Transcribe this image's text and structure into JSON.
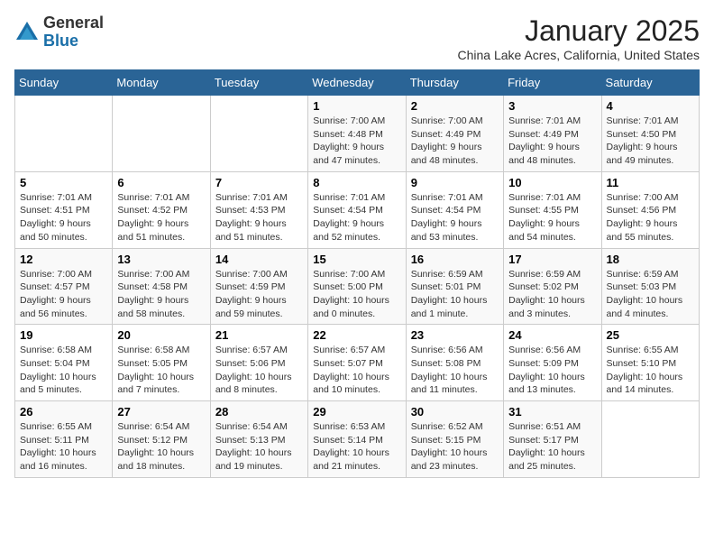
{
  "header": {
    "logo_general": "General",
    "logo_blue": "Blue",
    "month_title": "January 2025",
    "location": "China Lake Acres, California, United States"
  },
  "days_of_week": [
    "Sunday",
    "Monday",
    "Tuesday",
    "Wednesday",
    "Thursday",
    "Friday",
    "Saturday"
  ],
  "weeks": [
    [
      {
        "day": "",
        "info": ""
      },
      {
        "day": "",
        "info": ""
      },
      {
        "day": "",
        "info": ""
      },
      {
        "day": "1",
        "info": "Sunrise: 7:00 AM\nSunset: 4:48 PM\nDaylight: 9 hours and 47 minutes."
      },
      {
        "day": "2",
        "info": "Sunrise: 7:00 AM\nSunset: 4:49 PM\nDaylight: 9 hours and 48 minutes."
      },
      {
        "day": "3",
        "info": "Sunrise: 7:01 AM\nSunset: 4:49 PM\nDaylight: 9 hours and 48 minutes."
      },
      {
        "day": "4",
        "info": "Sunrise: 7:01 AM\nSunset: 4:50 PM\nDaylight: 9 hours and 49 minutes."
      }
    ],
    [
      {
        "day": "5",
        "info": "Sunrise: 7:01 AM\nSunset: 4:51 PM\nDaylight: 9 hours and 50 minutes."
      },
      {
        "day": "6",
        "info": "Sunrise: 7:01 AM\nSunset: 4:52 PM\nDaylight: 9 hours and 51 minutes."
      },
      {
        "day": "7",
        "info": "Sunrise: 7:01 AM\nSunset: 4:53 PM\nDaylight: 9 hours and 51 minutes."
      },
      {
        "day": "8",
        "info": "Sunrise: 7:01 AM\nSunset: 4:54 PM\nDaylight: 9 hours and 52 minutes."
      },
      {
        "day": "9",
        "info": "Sunrise: 7:01 AM\nSunset: 4:54 PM\nDaylight: 9 hours and 53 minutes."
      },
      {
        "day": "10",
        "info": "Sunrise: 7:01 AM\nSunset: 4:55 PM\nDaylight: 9 hours and 54 minutes."
      },
      {
        "day": "11",
        "info": "Sunrise: 7:00 AM\nSunset: 4:56 PM\nDaylight: 9 hours and 55 minutes."
      }
    ],
    [
      {
        "day": "12",
        "info": "Sunrise: 7:00 AM\nSunset: 4:57 PM\nDaylight: 9 hours and 56 minutes."
      },
      {
        "day": "13",
        "info": "Sunrise: 7:00 AM\nSunset: 4:58 PM\nDaylight: 9 hours and 58 minutes."
      },
      {
        "day": "14",
        "info": "Sunrise: 7:00 AM\nSunset: 4:59 PM\nDaylight: 9 hours and 59 minutes."
      },
      {
        "day": "15",
        "info": "Sunrise: 7:00 AM\nSunset: 5:00 PM\nDaylight: 10 hours and 0 minutes."
      },
      {
        "day": "16",
        "info": "Sunrise: 6:59 AM\nSunset: 5:01 PM\nDaylight: 10 hours and 1 minute."
      },
      {
        "day": "17",
        "info": "Sunrise: 6:59 AM\nSunset: 5:02 PM\nDaylight: 10 hours and 3 minutes."
      },
      {
        "day": "18",
        "info": "Sunrise: 6:59 AM\nSunset: 5:03 PM\nDaylight: 10 hours and 4 minutes."
      }
    ],
    [
      {
        "day": "19",
        "info": "Sunrise: 6:58 AM\nSunset: 5:04 PM\nDaylight: 10 hours and 5 minutes."
      },
      {
        "day": "20",
        "info": "Sunrise: 6:58 AM\nSunset: 5:05 PM\nDaylight: 10 hours and 7 minutes."
      },
      {
        "day": "21",
        "info": "Sunrise: 6:57 AM\nSunset: 5:06 PM\nDaylight: 10 hours and 8 minutes."
      },
      {
        "day": "22",
        "info": "Sunrise: 6:57 AM\nSunset: 5:07 PM\nDaylight: 10 hours and 10 minutes."
      },
      {
        "day": "23",
        "info": "Sunrise: 6:56 AM\nSunset: 5:08 PM\nDaylight: 10 hours and 11 minutes."
      },
      {
        "day": "24",
        "info": "Sunrise: 6:56 AM\nSunset: 5:09 PM\nDaylight: 10 hours and 13 minutes."
      },
      {
        "day": "25",
        "info": "Sunrise: 6:55 AM\nSunset: 5:10 PM\nDaylight: 10 hours and 14 minutes."
      }
    ],
    [
      {
        "day": "26",
        "info": "Sunrise: 6:55 AM\nSunset: 5:11 PM\nDaylight: 10 hours and 16 minutes."
      },
      {
        "day": "27",
        "info": "Sunrise: 6:54 AM\nSunset: 5:12 PM\nDaylight: 10 hours and 18 minutes."
      },
      {
        "day": "28",
        "info": "Sunrise: 6:54 AM\nSunset: 5:13 PM\nDaylight: 10 hours and 19 minutes."
      },
      {
        "day": "29",
        "info": "Sunrise: 6:53 AM\nSunset: 5:14 PM\nDaylight: 10 hours and 21 minutes."
      },
      {
        "day": "30",
        "info": "Sunrise: 6:52 AM\nSunset: 5:15 PM\nDaylight: 10 hours and 23 minutes."
      },
      {
        "day": "31",
        "info": "Sunrise: 6:51 AM\nSunset: 5:17 PM\nDaylight: 10 hours and 25 minutes."
      },
      {
        "day": "",
        "info": ""
      }
    ]
  ]
}
